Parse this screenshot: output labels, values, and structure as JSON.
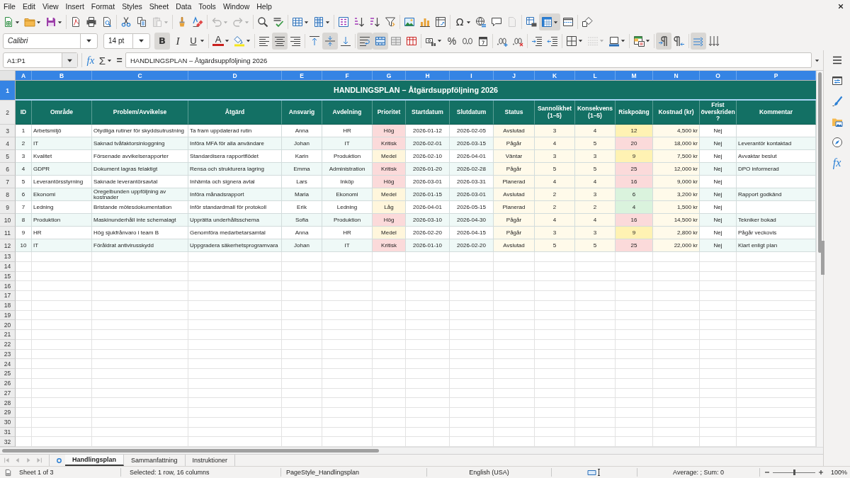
{
  "menu": [
    "File",
    "Edit",
    "View",
    "Insert",
    "Format",
    "Styles",
    "Sheet",
    "Data",
    "Tools",
    "Window",
    "Help"
  ],
  "standard_toolbar": [
    {
      "on": false,
      "disabled": false
    },
    {
      "on": false,
      "disabled": false
    },
    {
      "on": false,
      "disabled": false
    },
    {
      "on": false,
      "disabled": false
    },
    {
      "on": false,
      "disabled": false
    },
    {
      "on": false,
      "disabled": false
    },
    {
      "on": false,
      "disabled": false
    },
    {
      "on": false,
      "disabled": false
    },
    {
      "on": false,
      "disabled": true
    },
    {
      "on": false,
      "disabled": false
    },
    {
      "on": false,
      "disabled": false
    },
    {
      "on": false,
      "disabled": true
    },
    {
      "on": false,
      "disabled": true
    },
    {
      "on": false,
      "disabled": false
    },
    {
      "on": false,
      "disabled": false
    },
    {
      "on": false,
      "disabled": false
    },
    {
      "on": false,
      "disabled": false
    },
    {
      "on": false,
      "disabled": false
    },
    {
      "on": false,
      "disabled": false
    },
    {
      "on": false,
      "disabled": false
    },
    {
      "on": false,
      "disabled": false
    },
    {
      "on": false,
      "disabled": false
    },
    {
      "on": false,
      "disabled": false
    },
    {
      "on": false,
      "disabled": false
    },
    {
      "label": "Ω",
      "on": false,
      "disabled": false
    },
    {
      "on": false,
      "disabled": false
    },
    {
      "on": false,
      "disabled": false
    },
    {
      "on": false,
      "disabled": true
    },
    {
      "on": false,
      "disabled": false
    },
    {
      "on": true,
      "disabled": false
    },
    {
      "on": false,
      "disabled": false
    },
    {
      "on": false,
      "disabled": false
    }
  ],
  "formatting_toolbar": {
    "font_name": "Calibri",
    "font_size": "14 pt",
    "buttons": [
      {
        "label": "B",
        "on": true,
        "disabled": false
      },
      {
        "label": "I",
        "on": false,
        "disabled": false
      },
      {
        "label": "U",
        "on": false,
        "disabled": false
      },
      {
        "label": "A",
        "on": false,
        "disabled": false
      },
      {
        "on": false,
        "disabled": false
      },
      {
        "on": false,
        "disabled": false
      },
      {
        "on": true,
        "disabled": false
      },
      {
        "on": false,
        "disabled": false
      },
      {
        "on": false,
        "disabled": false
      },
      {
        "on": true,
        "disabled": false
      },
      {
        "on": false,
        "disabled": false
      },
      {
        "on": true,
        "disabled": false
      },
      {
        "on": true,
        "disabled": false
      },
      {
        "on": false,
        "disabled": false
      },
      {
        "on": false,
        "disabled": false
      },
      {
        "on": false,
        "disabled": false
      },
      {
        "label": "%",
        "on": false,
        "disabled": false
      },
      {
        "on": false,
        "disabled": false
      },
      {
        "on": false,
        "disabled": false
      },
      {
        "on": false,
        "disabled": false
      },
      {
        "on": false,
        "disabled": false
      },
      {
        "on": false,
        "disabled": false
      },
      {
        "on": false,
        "disabled": false
      },
      {
        "on": false,
        "disabled": false
      },
      {
        "on": false,
        "disabled": true
      },
      {
        "on": false,
        "disabled": false
      },
      {
        "on": false,
        "disabled": false
      },
      {
        "on": true,
        "disabled": false
      },
      {
        "on": false,
        "disabled": false
      },
      {
        "on": true,
        "disabled": false
      },
      {
        "on": false,
        "disabled": false
      }
    ]
  },
  "formula_bar": {
    "name_box": "A1:P1",
    "function_wizard": "fx",
    "sum": "Σ",
    "formula": "=",
    "content": "HANDLINGSPLAN – Åtgärdsuppföljning 2026"
  },
  "sidebar": {
    "tabs": [
      {
        "selected": false
      },
      {
        "selected": false
      },
      {
        "selected": false
      },
      {
        "selected": false
      },
      {
        "label": "fx",
        "selected": false
      }
    ]
  },
  "sheet": {
    "columns": [
      {
        "label": "A",
        "selected": true
      },
      {
        "label": "B",
        "selected": true
      },
      {
        "label": "C",
        "selected": true
      },
      {
        "label": "D",
        "selected": true
      },
      {
        "label": "E",
        "selected": true
      },
      {
        "label": "F",
        "selected": true
      },
      {
        "label": "G",
        "selected": true
      },
      {
        "label": "H",
        "selected": true
      },
      {
        "label": "I",
        "selected": true
      },
      {
        "label": "J",
        "selected": true
      },
      {
        "label": "K",
        "selected": true
      },
      {
        "label": "L",
        "selected": true
      },
      {
        "label": "M",
        "selected": true
      },
      {
        "label": "N",
        "selected": true
      },
      {
        "label": "O",
        "selected": true
      },
      {
        "label": "P",
        "selected": true
      }
    ],
    "rows": [
      {
        "label": "1",
        "selected": true
      },
      {
        "label": "2",
        "selected": false
      },
      {
        "label": "3",
        "selected": false
      },
      {
        "label": "4",
        "selected": false
      },
      {
        "label": "5",
        "selected": false
      },
      {
        "label": "6",
        "selected": false
      },
      {
        "label": "7",
        "selected": false
      },
      {
        "label": "8",
        "selected": false
      },
      {
        "label": "9",
        "selected": false
      },
      {
        "label": "10",
        "selected": false
      },
      {
        "label": "11",
        "selected": false
      },
      {
        "label": "12",
        "selected": false
      },
      {
        "label": "13",
        "selected": false
      },
      {
        "label": "14",
        "selected": false
      },
      {
        "label": "15",
        "selected": false
      },
      {
        "label": "16",
        "selected": false
      },
      {
        "label": "17",
        "selected": false
      },
      {
        "label": "18",
        "selected": false
      },
      {
        "label": "19",
        "selected": false
      },
      {
        "label": "20",
        "selected": false
      },
      {
        "label": "21",
        "selected": false
      },
      {
        "label": "22",
        "selected": false
      },
      {
        "label": "23",
        "selected": false
      },
      {
        "label": "24",
        "selected": false
      },
      {
        "label": "25",
        "selected": false
      },
      {
        "label": "26",
        "selected": false
      },
      {
        "label": "27",
        "selected": false
      },
      {
        "label": "28",
        "selected": false
      },
      {
        "label": "29",
        "selected": false
      },
      {
        "label": "30",
        "selected": false
      },
      {
        "label": "31",
        "selected": false
      },
      {
        "label": "32",
        "selected": false
      }
    ],
    "title": "HANDLINGSPLAN – Åtgärdsuppföljning 2026",
    "headers": [
      "ID",
      "Område",
      "Problem/Avvikelse",
      "Åtgärd",
      "Ansvarig",
      "Avdelning",
      "Prioritet",
      "Startdatum",
      "Slutdatum",
      "Status",
      "Sannolikhet (1–5)",
      "Konsekvens (1–5)",
      "Riskpoäng",
      "Kostnad (kr)",
      "Frist överskriden?",
      "Kommentar"
    ],
    "records": [
      {
        "id": "1",
        "area": "Arbetsmiljö",
        "problem": "Otydliga rutiner för skyddsutrustning",
        "action": "Ta fram uppdaterad rutin",
        "owner": "Anna",
        "department": "HR",
        "priority": {
          "text": "Hög",
          "color": "#fbdada"
        },
        "start": "2026-01-12",
        "end": "2026-02-05",
        "status": "Avslutad",
        "probability": "3",
        "consequence": "4",
        "risk": {
          "text": "12",
          "color": "#fff2b3"
        },
        "cost": "4,500 kr",
        "overdue": "Nej"
      },
      {
        "id": "2",
        "area": "IT",
        "problem": "Saknad tvåfaktorsinloggning",
        "action": "Införa MFA för alla användare",
        "owner": "Johan",
        "department": "IT",
        "priority": {
          "text": "Kritisk",
          "color": "#fbdada"
        },
        "start": "2026-02-01",
        "end": "2026-03-15",
        "status": "Pågår",
        "probability": "4",
        "consequence": "5",
        "risk": {
          "text": "20",
          "color": "#fbdada"
        },
        "cost": "18,000 kr",
        "overdue": "Nej",
        "comment": "Leverantör kontaktad"
      },
      {
        "id": "3",
        "area": "Kvalitet",
        "problem": "Försenade avvikelserapporter",
        "action": "Standardisera rapportflödet",
        "owner": "Karin",
        "department": "Produktion",
        "priority": {
          "text": "Medel",
          "color": "#fff6dc"
        },
        "start": "2026-02-10",
        "end": "2026-04-01",
        "status": "Väntar",
        "probability": "3",
        "consequence": "3",
        "risk": {
          "text": "9",
          "color": "#fff2b3"
        },
        "cost": "7,500 kr",
        "overdue": "Nej",
        "comment": "Avvaktar beslut"
      },
      {
        "id": "4",
        "area": "GDPR",
        "problem": "Dokument lagras felaktigt",
        "action": "Rensa och strukturera lagring",
        "owner": "Emma",
        "department": "Administration",
        "priority": {
          "text": "Kritisk",
          "color": "#fbdada"
        },
        "start": "2026-01-20",
        "end": "2026-02-28",
        "status": "Pågår",
        "probability": "5",
        "consequence": "5",
        "risk": {
          "text": "25",
          "color": "#fbdada"
        },
        "cost": "12,000 kr",
        "overdue": "Nej",
        "comment": "DPO informerad"
      },
      {
        "id": "5",
        "area": "Leverantörsstyrning",
        "problem": "Saknade leverantörsavtal",
        "action": "Inhämta och signera avtal",
        "owner": "Lars",
        "department": "Inköp",
        "priority": {
          "text": "Hög",
          "color": "#fbdada"
        },
        "start": "2026-03-01",
        "end": "2026-03-31",
        "status": "Planerad",
        "probability": "4",
        "consequence": "4",
        "risk": {
          "text": "16",
          "color": "#fbdada"
        },
        "cost": "9,000 kr",
        "overdue": "Nej"
      },
      {
        "id": "6",
        "area": "Ekonomi",
        "problem": "Oregelbunden uppföljning av kostnader",
        "action": "Införa månadsrapport",
        "owner": "Maria",
        "department": "Ekonomi",
        "priority": {
          "text": "Medel",
          "color": "#fff6dc"
        },
        "start": "2026-01-15",
        "end": "2026-03-01",
        "status": "Avslutad",
        "probability": "2",
        "consequence": "3",
        "risk": {
          "text": "6",
          "color": "#daf3dd"
        },
        "cost": "3,200 kr",
        "overdue": "Nej",
        "comment": "Rapport godkänd"
      },
      {
        "id": "7",
        "area": "Ledning",
        "problem": "Bristande mötesdokumentation",
        "action": "Inför standardmall för protokoll",
        "owner": "Erik",
        "department": "Ledning",
        "priority": {
          "text": "Låg",
          "color": "#fff6dc"
        },
        "start": "2026-04-01",
        "end": "2026-05-15",
        "status": "Planerad",
        "probability": "2",
        "consequence": "2",
        "risk": {
          "text": "4",
          "color": "#daf3dd"
        },
        "cost": "1,500 kr",
        "overdue": "Nej"
      },
      {
        "id": "8",
        "area": "Produktion",
        "problem": "Maskinunderhåll inte schemalagt",
        "action": "Upprätta underhållsschema",
        "owner": "Sofia",
        "department": "Produktion",
        "priority": {
          "text": "Hög",
          "color": "#fbdada"
        },
        "start": "2026-03-10",
        "end": "2026-04-30",
        "status": "Pågår",
        "probability": "4",
        "consequence": "4",
        "risk": {
          "text": "16",
          "color": "#fbdada"
        },
        "cost": "14,500 kr",
        "overdue": "Nej",
        "comment": "Tekniker bokad"
      },
      {
        "id": "9",
        "area": "HR",
        "problem": "Hög sjukfrånvaro i team B",
        "action": "Genomföra medarbetarsamtal",
        "owner": "Anna",
        "department": "HR",
        "priority": {
          "text": "Medel",
          "color": "#fff6dc"
        },
        "start": "2026-02-20",
        "end": "2026-04-15",
        "status": "Pågår",
        "probability": "3",
        "consequence": "3",
        "risk": {
          "text": "9",
          "color": "#fff2b3"
        },
        "cost": "2,800 kr",
        "overdue": "Nej",
        "comment": "Pågår veckovis"
      },
      {
        "id": "10",
        "area": "IT",
        "problem": "Föråldrat antivirusskydd",
        "action": "Uppgradera säkerhetsprogramvara",
        "owner": "Johan",
        "department": "IT",
        "priority": {
          "text": "Kritisk",
          "color": "#fbdada"
        },
        "start": "2026-01-10",
        "end": "2026-02-20",
        "status": "Avslutad",
        "probability": "5",
        "consequence": "5",
        "risk": {
          "text": "25",
          "color": "#fbdada"
        },
        "cost": "22,000 kr",
        "overdue": "Nej",
        "comment": "Klart enligt plan"
      }
    ]
  },
  "sheet_tabs": {
    "navigation": [
      {
        "disabled": true
      },
      {
        "disabled": true
      },
      {
        "disabled": true
      },
      {
        "disabled": true
      }
    ],
    "tabs": [
      {
        "label": "Handlingsplan",
        "selected": true
      },
      {
        "label": "Sammanfattning",
        "selected": false
      },
      {
        "label": "Instruktioner",
        "selected": false
      }
    ]
  },
  "status_bar": {
    "sheet": "Sheet 1 of 3",
    "selection": "Selected: 1 row, 16 columns",
    "page_style": "PageStyle_Handlingsplan",
    "language": "English (USA)",
    "summary": "Average: ; Sum: 0",
    "zoom": {
      "level": 0.5,
      "reading": "100%"
    }
  }
}
